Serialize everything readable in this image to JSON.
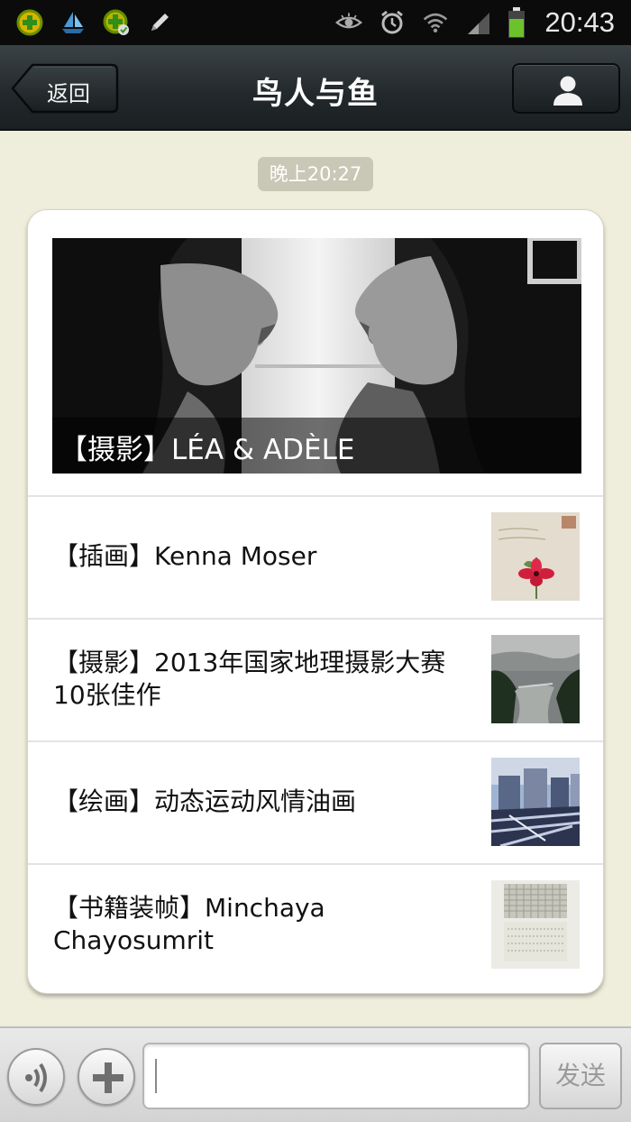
{
  "status_bar": {
    "time": "20:43",
    "left_icons": [
      "tencent-security-icon",
      "boat-notification-icon",
      "synced-app-icon",
      "pencil-icon"
    ],
    "right_icons": [
      "eye-icon",
      "alarm-clock-icon",
      "wifi-icon",
      "signal-icon",
      "battery-icon"
    ]
  },
  "header": {
    "back_label": "返回",
    "title": "鸟人与鱼",
    "profile_icon": "person-icon"
  },
  "chat": {
    "timestamp": "晚上20:27"
  },
  "article": {
    "cover_caption": "【摄影】LÉA & ADÈLE",
    "items": [
      {
        "title": "【插画】Kenna Moser",
        "thumb": "illustration-flower-thumbnail"
      },
      {
        "title": "【摄影】2013年国家地理摄影大赛10张佳作",
        "thumb": "landscape-river-thumbnail"
      },
      {
        "title": "【绘画】动态运动风情油画",
        "thumb": "painting-street-thumbnail"
      },
      {
        "title": "【书籍装帧】Minchaya Chayosumrit",
        "thumb": "book-pattern-thumbnail"
      }
    ]
  },
  "input_bar": {
    "voice_icon": "voice-icon",
    "plus_icon": "plus-icon",
    "input_value": "",
    "send_label": "发送"
  },
  "colors": {
    "background": "#efeddb",
    "titlebar": "#22282b",
    "timestamp_bg": "#c9c7b5",
    "card_bg": "#ffffff"
  }
}
